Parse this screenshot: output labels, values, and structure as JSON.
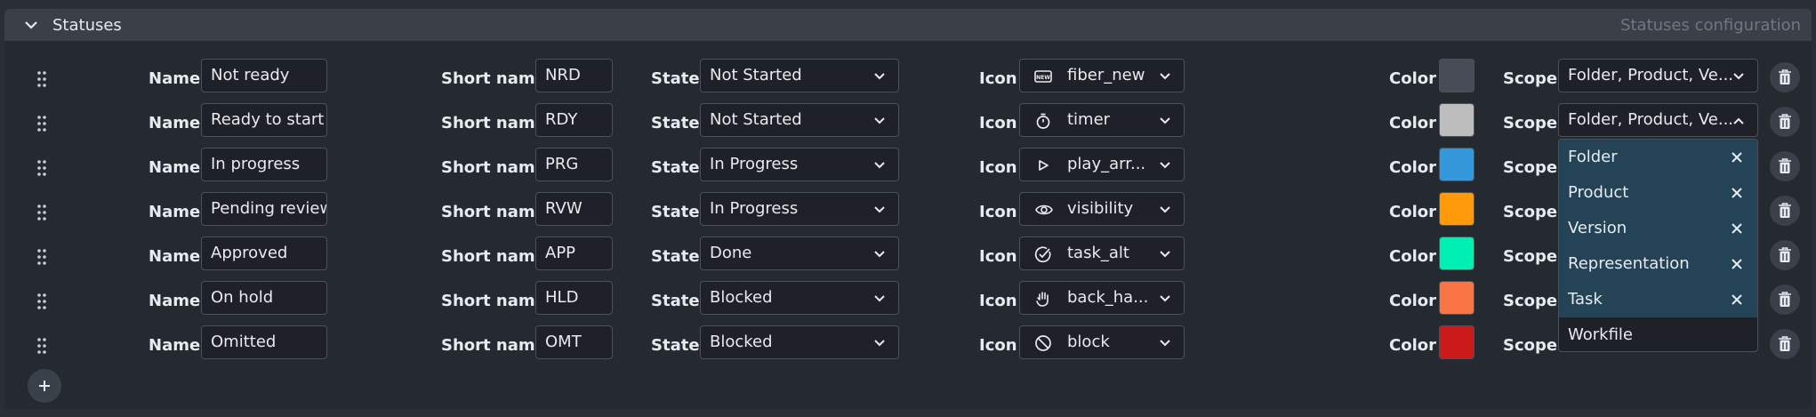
{
  "section": {
    "title": "Statuses",
    "subtitle": "Statuses configuration"
  },
  "labels": {
    "name": "Name",
    "short_name": "Short name",
    "state": "State",
    "icon": "Icon",
    "color": "Color",
    "scope": "Scope"
  },
  "rows": [
    {
      "name": "Not ready",
      "short": "NRD",
      "state": "Not Started",
      "icon": "fiber_new",
      "icon_name": "fiber-new-icon",
      "color": "#474c56",
      "scope": "Folder, Product, Ve..."
    },
    {
      "name": "Ready to start",
      "short": "RDY",
      "state": "Not Started",
      "icon": "timer",
      "icon_name": "timer-icon",
      "color": "#bdbdbd",
      "scope": "Folder, Product, Ve..."
    },
    {
      "name": "In progress",
      "short": "PRG",
      "state": "In Progress",
      "icon": "play_arr...",
      "icon_name": "play-arrow-icon",
      "color": "#3498db",
      "scope": ""
    },
    {
      "name": "Pending review",
      "short": "RVW",
      "state": "In Progress",
      "icon": "visibility",
      "icon_name": "visibility-icon",
      "color": "#ff9b0a",
      "scope": ""
    },
    {
      "name": "Approved",
      "short": "APP",
      "state": "Done",
      "icon": "task_alt",
      "icon_name": "task-alt-icon",
      "color": "#00f0b4",
      "scope": ""
    },
    {
      "name": "On hold",
      "short": "HLD",
      "state": "Blocked",
      "icon": "back_ha...",
      "icon_name": "back-hand-icon",
      "color": "#fa7545",
      "scope": ""
    },
    {
      "name": "Omitted",
      "short": "OMT",
      "state": "Blocked",
      "icon": "block",
      "icon_name": "block-icon",
      "color": "#cb1a1a",
      "scope": ""
    }
  ],
  "scope_dropdown": {
    "options": [
      {
        "label": "Folder",
        "selected": true
      },
      {
        "label": "Product",
        "selected": true
      },
      {
        "label": "Version",
        "selected": true
      },
      {
        "label": "Representation",
        "selected": true
      },
      {
        "label": "Task",
        "selected": true
      },
      {
        "label": "Workfile",
        "selected": false
      }
    ]
  }
}
